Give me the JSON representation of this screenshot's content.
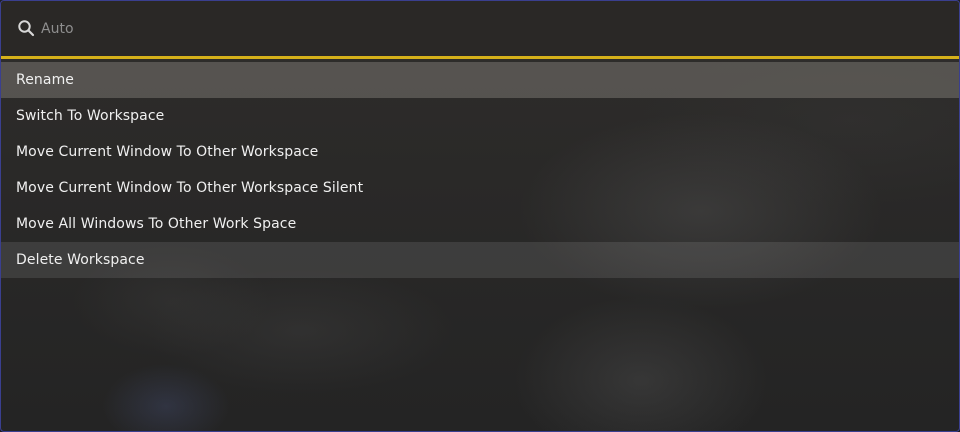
{
  "search": {
    "placeholder": "Auto",
    "value": "",
    "icon": "search-icon",
    "accent_color": "#d6b11a"
  },
  "menu": {
    "items": [
      {
        "label": "Rename",
        "state": "selected"
      },
      {
        "label": "Switch To Workspace",
        "state": "normal"
      },
      {
        "label": "Move Current Window To Other Workspace",
        "state": "normal"
      },
      {
        "label": "Move Current Window To Other Workspace Silent",
        "state": "normal"
      },
      {
        "label": "Move All Windows To Other Work Space",
        "state": "normal"
      },
      {
        "label": "Delete Workspace",
        "state": "hover"
      }
    ]
  }
}
